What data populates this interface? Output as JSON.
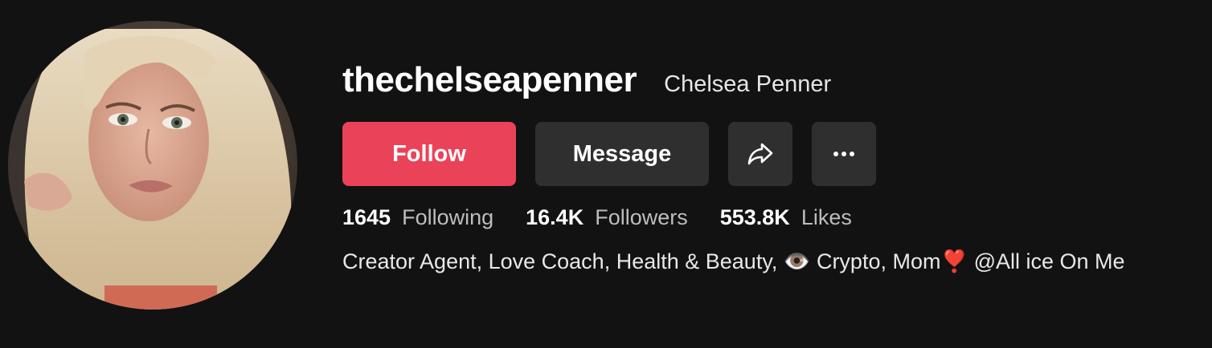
{
  "profile": {
    "username": "thechelseapenner",
    "display_name": "Chelsea Penner",
    "avatar_icon": "profile-photo"
  },
  "actions": {
    "follow_label": "Follow",
    "message_label": "Message",
    "share_icon": "share-arrow-icon",
    "more_icon": "more-dots-icon"
  },
  "stats": {
    "following_count": "1645",
    "following_label": "Following",
    "followers_count": "16.4K",
    "followers_label": "Followers",
    "likes_count": "553.8K",
    "likes_label": "Likes"
  },
  "bio": "Creator Agent, Love Coach, Health & Beauty, 👁️ Crypto, Mom❣️ @All ice On Me",
  "colors": {
    "background": "#121212",
    "follow_button": "#ea4359",
    "secondary_button": "#2f2f2f",
    "muted_text": "#bdbdbd"
  }
}
